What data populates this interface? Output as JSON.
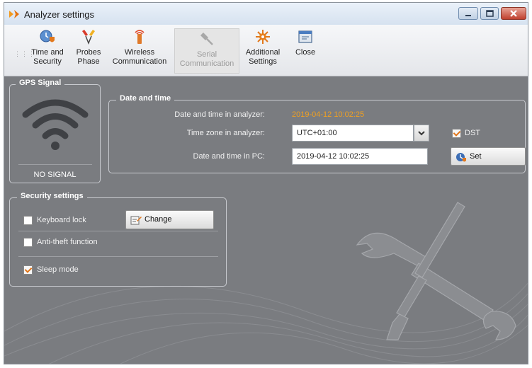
{
  "window": {
    "title": "Analyzer settings"
  },
  "toolbar": {
    "items": [
      {
        "line1": "Time and",
        "line2": "Security",
        "icon": "clock-shield-icon",
        "enabled": true
      },
      {
        "line1": "Probes",
        "line2": "Phase",
        "icon": "probes-icon",
        "enabled": true
      },
      {
        "line1": "Wireless",
        "line2": "Communication",
        "icon": "wireless-icon",
        "enabled": true
      },
      {
        "line1": "Serial",
        "line2": "Communication",
        "icon": "serial-plug-icon",
        "enabled": false
      },
      {
        "line1": "Additional",
        "line2": "Settings",
        "icon": "additional-settings-icon",
        "enabled": true
      },
      {
        "line1": "Close",
        "line2": "",
        "icon": "close-door-icon",
        "enabled": true
      }
    ]
  },
  "gps": {
    "title": "GPS Signal",
    "status": "NO SIGNAL"
  },
  "datetime": {
    "title": "Date and time",
    "analyzer_label": "Date and time in analyzer:",
    "analyzer_value": "2019-04-12 10:02:25",
    "timezone_label": "Time zone in analyzer:",
    "timezone_value": "UTC+01:00",
    "dst_label": "DST",
    "dst_checked": true,
    "pc_label": "Date and time in PC:",
    "pc_value": "2019-04-12 10:02:25",
    "set_label": "Set"
  },
  "security": {
    "title": "Security settings",
    "change_label": "Change",
    "options": [
      {
        "label": "Keyboard lock",
        "checked": false
      },
      {
        "label": "Anti-theft function",
        "checked": false
      },
      {
        "label": "Sleep mode",
        "checked": true
      }
    ]
  },
  "colors": {
    "panel_bg": "#7a7c80",
    "accent": "#f0a020",
    "check": "#e07418",
    "title_bar": "#dfe8f3"
  }
}
